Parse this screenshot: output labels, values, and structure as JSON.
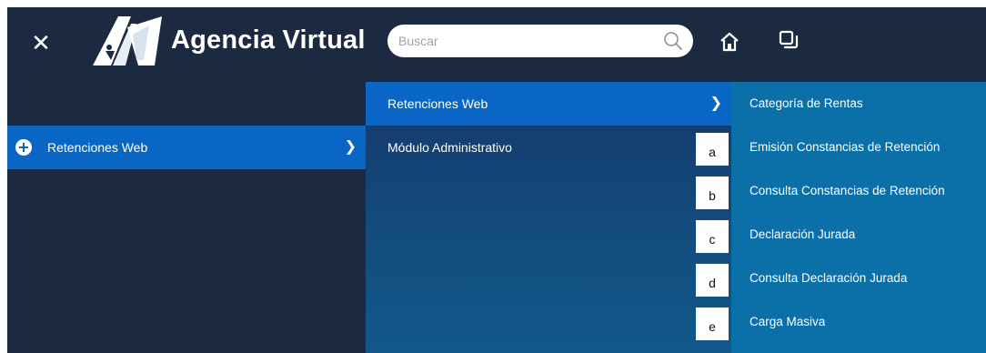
{
  "header": {
    "close_glyph": "✕",
    "brand_name": "Agencia Virtual",
    "logo_letters": "AV",
    "search": {
      "placeholder": "Buscar",
      "value": ""
    },
    "icons": [
      "close-icon",
      "search-icon",
      "home-icon",
      "windows-icon"
    ]
  },
  "menu_level1": {
    "items": [
      {
        "label": "Retenciones Web",
        "icon": "plus-circle-icon",
        "chevron": "❯",
        "active": true
      }
    ]
  },
  "menu_level2": {
    "items": [
      {
        "label": "Retenciones Web",
        "chevron": "❯",
        "active": true
      },
      {
        "label": "Módulo Administrativo",
        "active": false
      }
    ]
  },
  "menu_level3": {
    "items": [
      {
        "label": "Categoría de Rentas"
      },
      {
        "label": "Emisión Constancias de Retención",
        "marker": "a"
      },
      {
        "label": "Consulta Constancias de Retención",
        "marker": "b"
      },
      {
        "label": "Declaración Jurada",
        "marker": "c"
      },
      {
        "label": "Consulta Declaración Jurada",
        "marker": "d"
      },
      {
        "label": "Carga Masiva",
        "marker": "e"
      }
    ]
  },
  "colors": {
    "header_bg": "#1b2a40",
    "active_item": "#0966c4",
    "submenu_bg": "#134e7f",
    "options_bg": "#0b6fa8"
  }
}
